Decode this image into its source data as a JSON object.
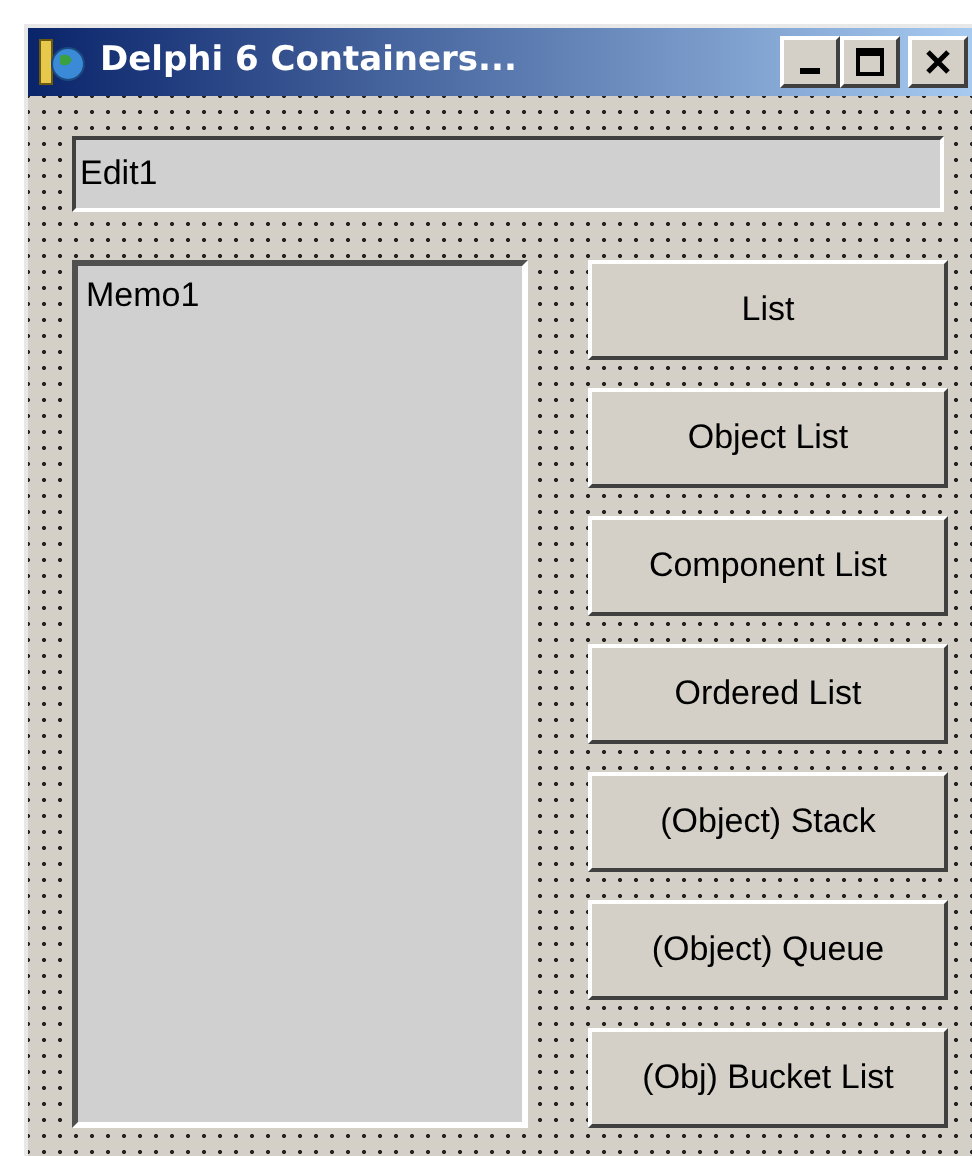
{
  "window": {
    "title": "Delphi 6 Containers..."
  },
  "edit": {
    "value": "Edit1"
  },
  "memo": {
    "text": "Memo1"
  },
  "buttons": [
    {
      "label": "List"
    },
    {
      "label": "Object List"
    },
    {
      "label": "Component List"
    },
    {
      "label": "Ordered List"
    },
    {
      "label": "(Object) Stack"
    },
    {
      "label": "(Object) Queue"
    },
    {
      "label": "(Obj) Bucket List"
    }
  ]
}
